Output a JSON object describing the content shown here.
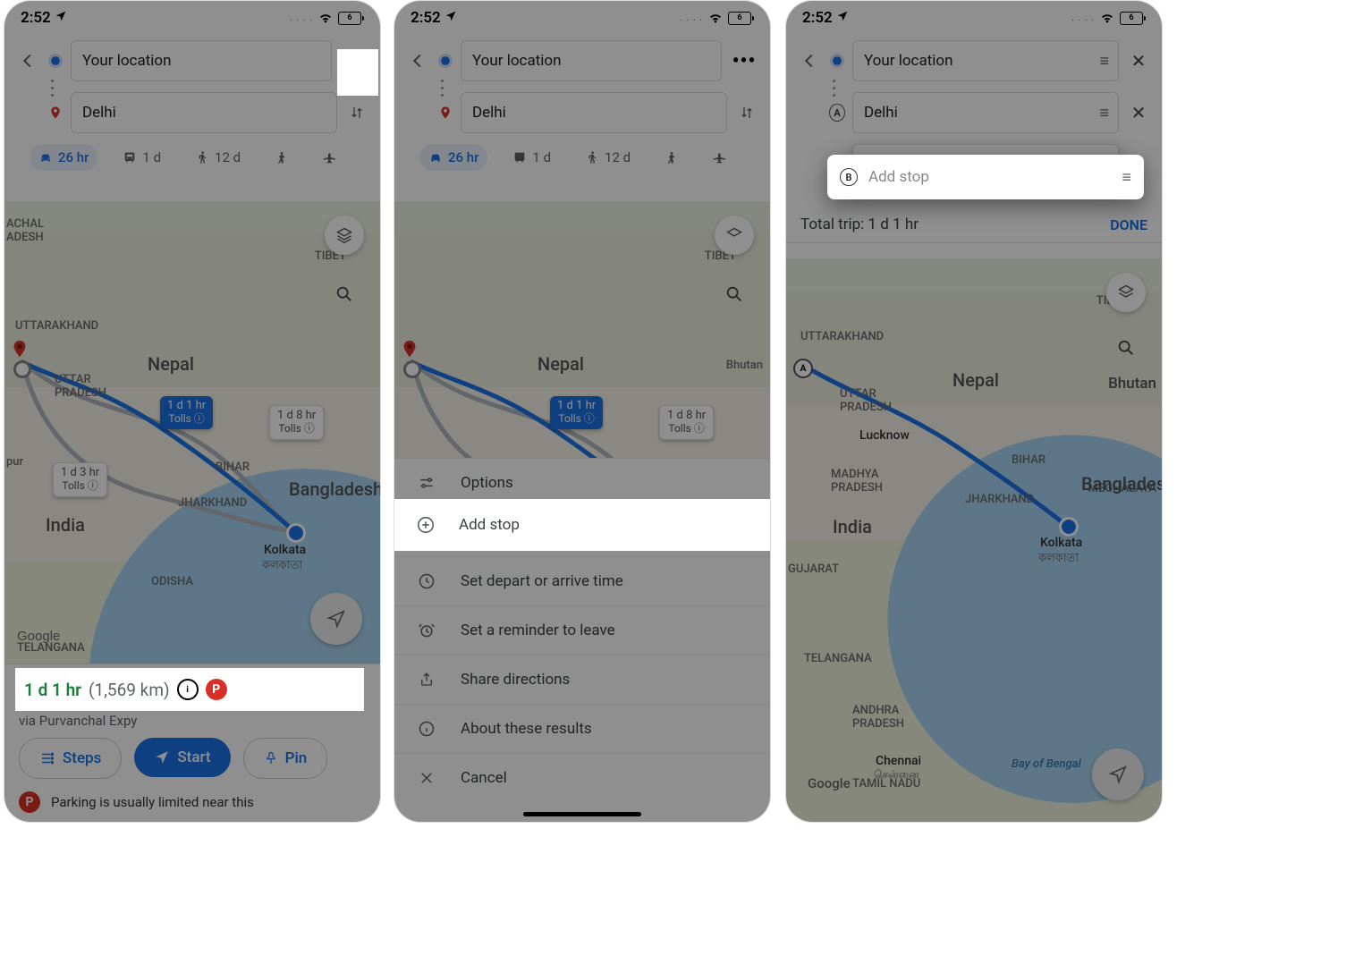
{
  "status": {
    "time": "2:52",
    "dots": ". . . .",
    "battery_label": "6"
  },
  "inputs": {
    "origin": "Your location",
    "dest": "Delhi",
    "add_stop_placeholder": "Add stop"
  },
  "modes": {
    "car": "26 hr",
    "transit": "1 d",
    "walk": "12 d",
    "rideshare": "",
    "flight": ""
  },
  "map_labels": {
    "tibet": "TIBET",
    "nepal": "Nepal",
    "india": "India",
    "bangladesh": "Bangladesh",
    "bhutan": "Bhutan",
    "uttarakhand": "UTTARAKHAND",
    "achal": "ACHAL\nADESH",
    "up": "UTTAR\nPRADESH",
    "bihar": "BIHAR",
    "jharkhand": "JHARKHAND",
    "odisha": "ODISHA",
    "telangana": "TELANGANA",
    "kolkata": "Kolkata",
    "kolkata_bn": "কলকাতা",
    "gujarat": "GUJARAT",
    "mp": "MADHYA\nPRADESH",
    "ap": "ANDHRA\nPRADESH",
    "tn": "TAMIL NADU",
    "chennai": "Chennai",
    "chennai_ta": "சென்னை",
    "bay": "Bay of Bengal",
    "lucknow": "Lucknow",
    "meghalaya": "MEGHALAYA",
    "pur": "pur",
    "google": "Google"
  },
  "route_chips": {
    "main": {
      "l1": "1 d 1 hr",
      "l2": "Tolls ⓘ"
    },
    "alt1": {
      "l1": "1 d 8 hr",
      "l2": "Tolls ⓘ"
    },
    "alt2": {
      "l1": "1 d 3 hr",
      "l2": "Tolls ⓘ"
    }
  },
  "summary": {
    "time": "1 d 1 hr",
    "dist": "(1,569 km)",
    "via": "via Purvanchal Expy",
    "steps": "Steps",
    "start": "Start",
    "pin": "Pin",
    "parking": "Parking is usually limited near this"
  },
  "action_sheet": {
    "options": "Options",
    "add_stop": "Add stop",
    "depart": "Set depart or arrive time",
    "reminder": "Set a reminder to leave",
    "share": "Share directions",
    "about": "About these results",
    "cancel": "Cancel"
  },
  "trip": {
    "total_label": "Total trip: ",
    "total_value": "1 d 1 hr",
    "done": "DONE",
    "stop_a": "A",
    "stop_b": "B"
  }
}
